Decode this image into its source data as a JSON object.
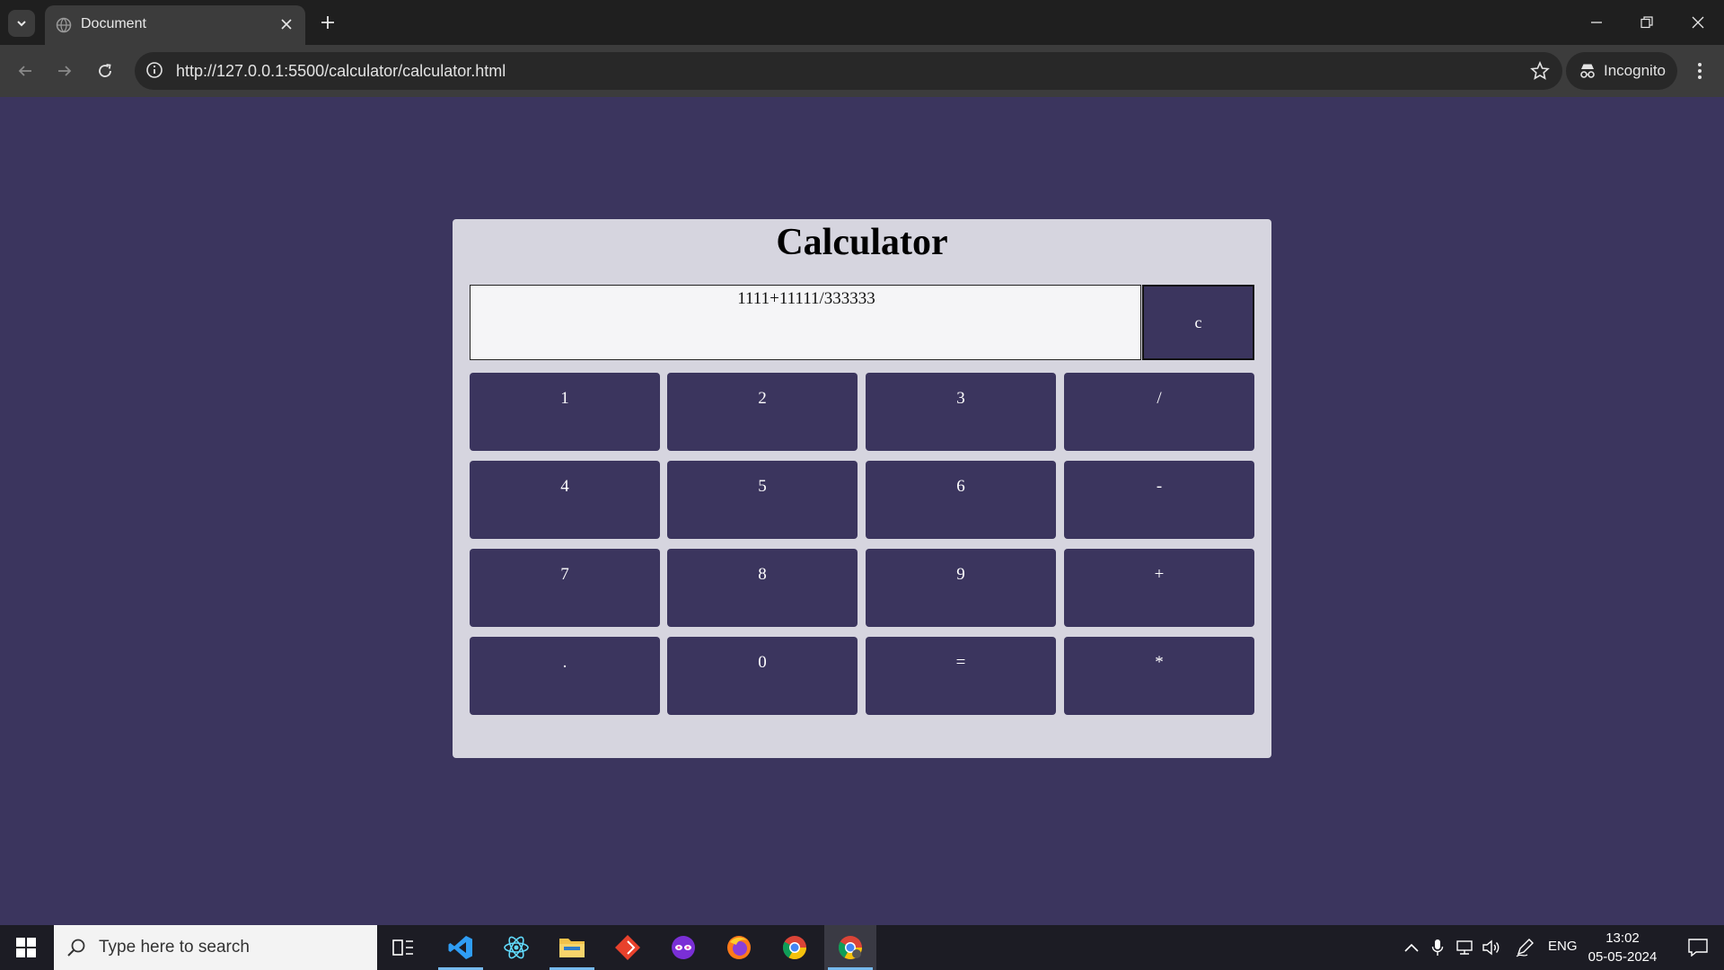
{
  "browser": {
    "tab_title": "Document",
    "url": "http://127.0.0.1:5500/calculator/calculator.html",
    "incognito_label": "Incognito"
  },
  "calculator": {
    "title": "Calculator",
    "display_value": "1111+11111/333333",
    "clear_label": "c",
    "keys": [
      "1",
      "2",
      "3",
      "/",
      "4",
      "5",
      "6",
      "-",
      "7",
      "8",
      "9",
      "+",
      ".",
      "0",
      "=",
      "*"
    ]
  },
  "taskbar": {
    "search_placeholder": "Type here to search",
    "language": "ENG",
    "time": "13:02",
    "date": "05-05-2024"
  },
  "colors": {
    "page_background": "#3b355e",
    "calculator_panel": "#d6d5df",
    "key_background": "#3b355e",
    "display_background": "#f5f5f7"
  }
}
